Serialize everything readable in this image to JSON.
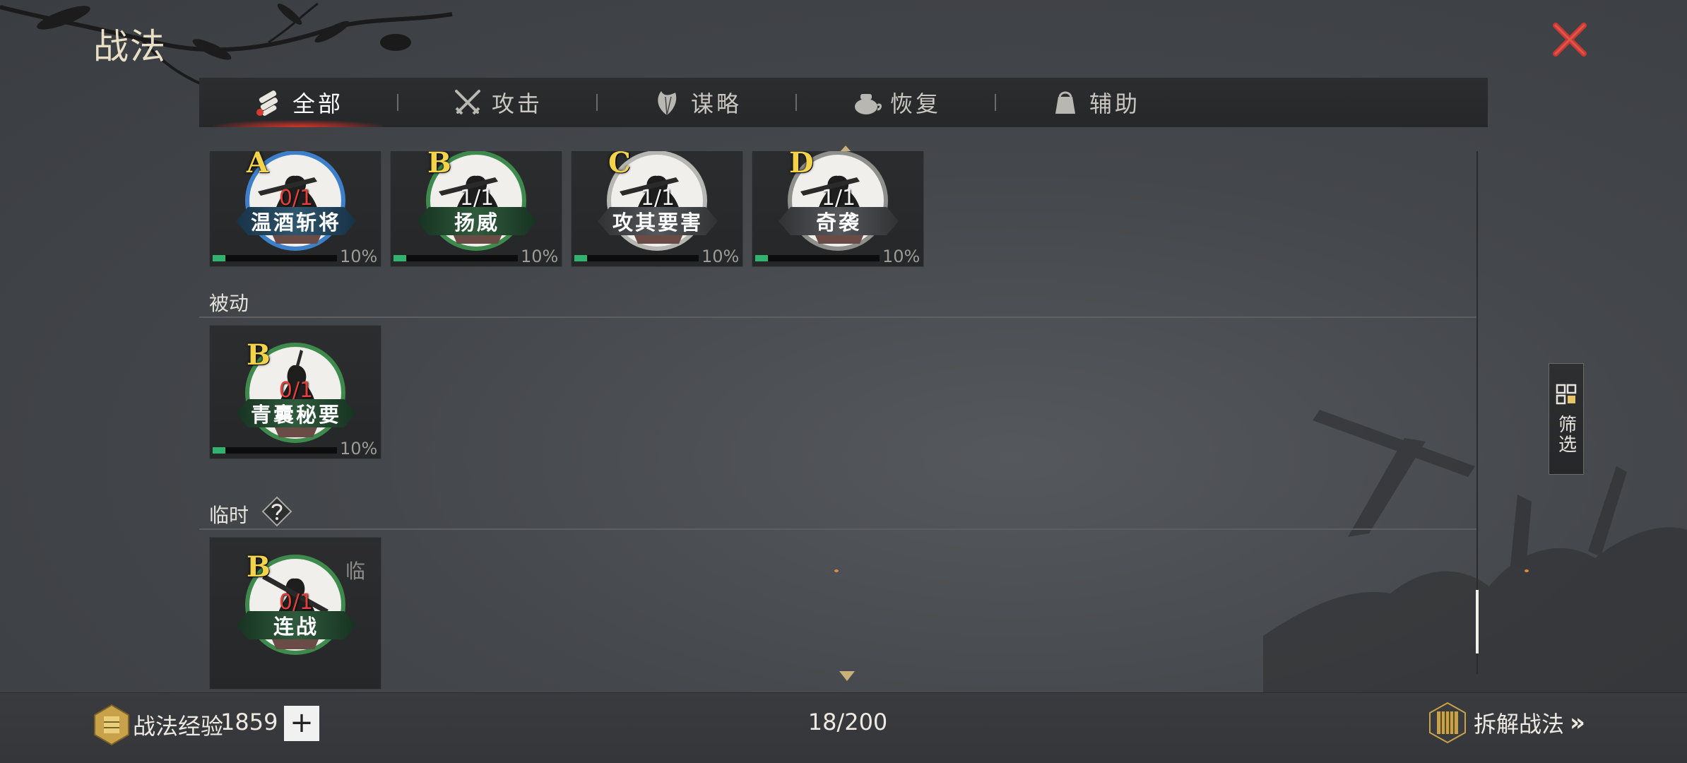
{
  "header": {
    "title": "战法"
  },
  "tabs": [
    {
      "label": "全部",
      "icon": "scroll-bundle-icon",
      "active": true
    },
    {
      "label": "攻击",
      "icon": "crossed-swords-icon",
      "active": false
    },
    {
      "label": "谋略",
      "icon": "feather-fan-icon",
      "active": false
    },
    {
      "label": "恢复",
      "icon": "medicine-pot-icon",
      "active": false
    },
    {
      "label": "辅助",
      "icon": "pouch-icon",
      "active": false
    }
  ],
  "active_cards": [
    {
      "grade": "A",
      "count": "0/1",
      "count_color": "red",
      "name": "温酒斩将",
      "ring": "#3d7fc9",
      "bar": "blue",
      "progress_percent": 10,
      "progress_label": "10%"
    },
    {
      "grade": "B",
      "count": "1/1",
      "count_color": "white",
      "name": "扬威",
      "ring": "#3e8a4c",
      "bar": "green",
      "progress_percent": 10,
      "progress_label": "10%"
    },
    {
      "grade": "C",
      "count": "1/1",
      "count_color": "white",
      "name": "攻其要害",
      "ring": "#b6b6b2",
      "bar": "gray",
      "progress_percent": 10,
      "progress_label": "10%"
    },
    {
      "grade": "D",
      "count": "1/1",
      "count_color": "white",
      "name": "奇袭",
      "ring": "#8e8e8b",
      "bar": "gray",
      "progress_percent": 10,
      "progress_label": "10%"
    }
  ],
  "passive": {
    "label": "被动",
    "cards": [
      {
        "grade": "B",
        "count": "0/1",
        "count_color": "red",
        "name": "青囊秘要",
        "ring": "#3e8a4c",
        "bar": "green",
        "progress_percent": 10,
        "progress_label": "10%"
      }
    ]
  },
  "temporary": {
    "label": "临时",
    "help_icon": "question-icon",
    "cards": [
      {
        "grade": "B",
        "count": "0/1",
        "count_color": "red",
        "name": "连战",
        "ring": "#3e8a4c",
        "bar": "green",
        "temp_mark": "临"
      }
    ]
  },
  "filter": {
    "label": "筛选",
    "icon": "grid-filter-icon"
  },
  "footer": {
    "exp_label": "战法经验",
    "exp_value": "1859",
    "add_label": "+",
    "inventory_count": "18/200",
    "dismantle_label": "拆解战法",
    "dismantle_arrow": "»"
  }
}
